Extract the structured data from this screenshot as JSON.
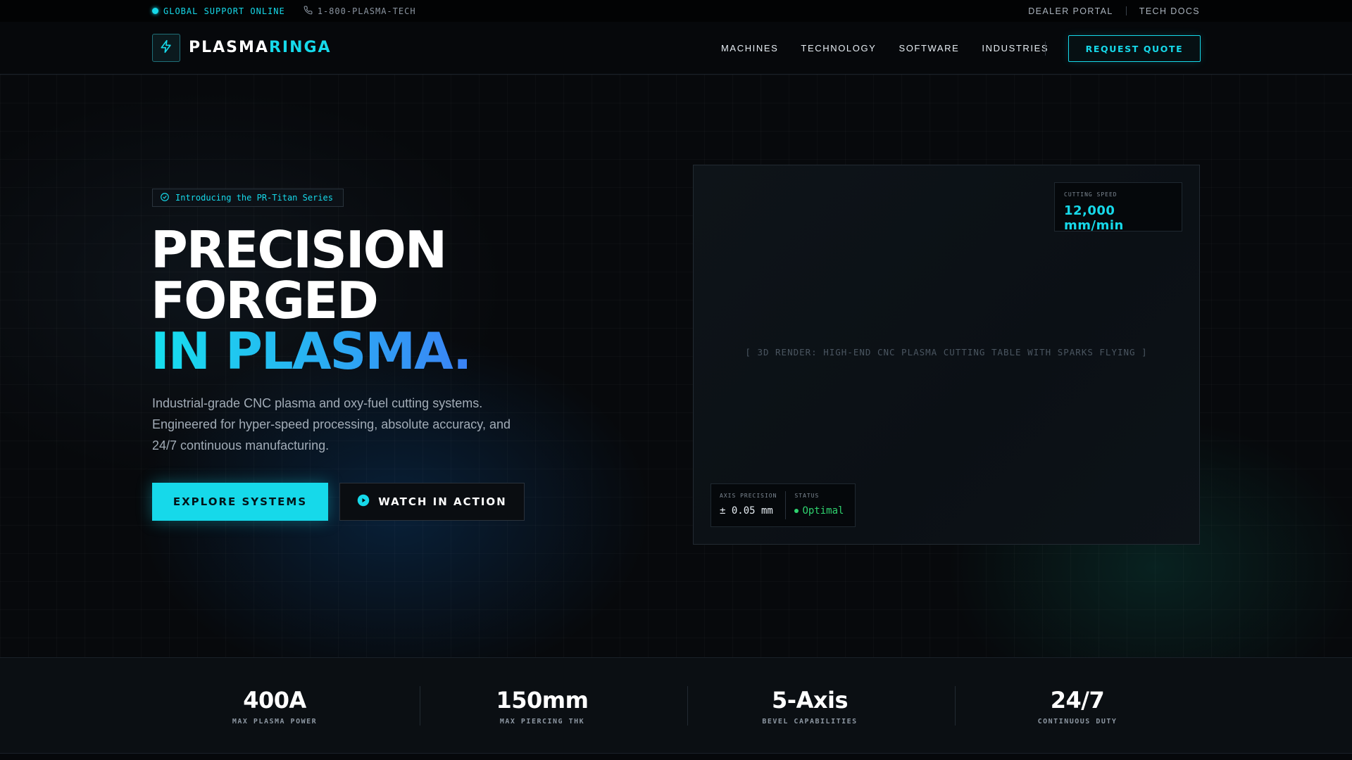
{
  "topbar": {
    "status": "GLOBAL SUPPORT ONLINE",
    "phone": "1-800-PLASMA-TECH",
    "links": [
      "DEALER PORTAL",
      "TECH DOCS"
    ]
  },
  "nav": {
    "logo_a": "PLASMA",
    "logo_b": "RINGA",
    "items": [
      "MACHINES",
      "TECHNOLOGY",
      "SOFTWARE",
      "INDUSTRIES"
    ],
    "cta": "REQUEST QUOTE"
  },
  "hero": {
    "badge": "Introducing the PR-Titan Series",
    "line1": "PRECISION",
    "line2": "FORGED",
    "line3": "IN PLASMA.",
    "sub_1": "Industrial-grade CNC plasma and oxy-fuel cutting systems.",
    "sub_2": "Engineered for hyper-speed processing, absolute accuracy, and",
    "sub_3": "24/7 continuous manufacturing.",
    "primary": "EXPLORE SYSTEMS",
    "secondary": "WATCH IN ACTION"
  },
  "panel": {
    "placeholder": "[ 3D RENDER: HIGH-END CNC PLASMA CUTTING TABLE WITH SPARKS FLYING ]",
    "speed_label": "CUTTING SPEED",
    "speed_value": "12,000 mm/min",
    "precision_label": "AXIS PRECISION",
    "precision_value": "± 0.05 mm",
    "status_label": "STATUS",
    "status_value": "Optimal"
  },
  "stats": [
    {
      "value": "400A",
      "label": "MAX PLASMA POWER"
    },
    {
      "value": "150mm",
      "label": "MAX PIERCING THK"
    },
    {
      "value": "5-Axis",
      "label": "BEVEL CAPABILITIES"
    },
    {
      "value": "24/7",
      "label": "CONTINUOUS DUTY"
    }
  ],
  "colors": {
    "accent": "#16d9ea",
    "gradient_end": "#3b82f6",
    "status_ok": "#2fd36f",
    "background": "#07090c"
  },
  "icons": [
    "bolt-icon",
    "phone-icon",
    "check-circle-icon",
    "play-icon"
  ]
}
